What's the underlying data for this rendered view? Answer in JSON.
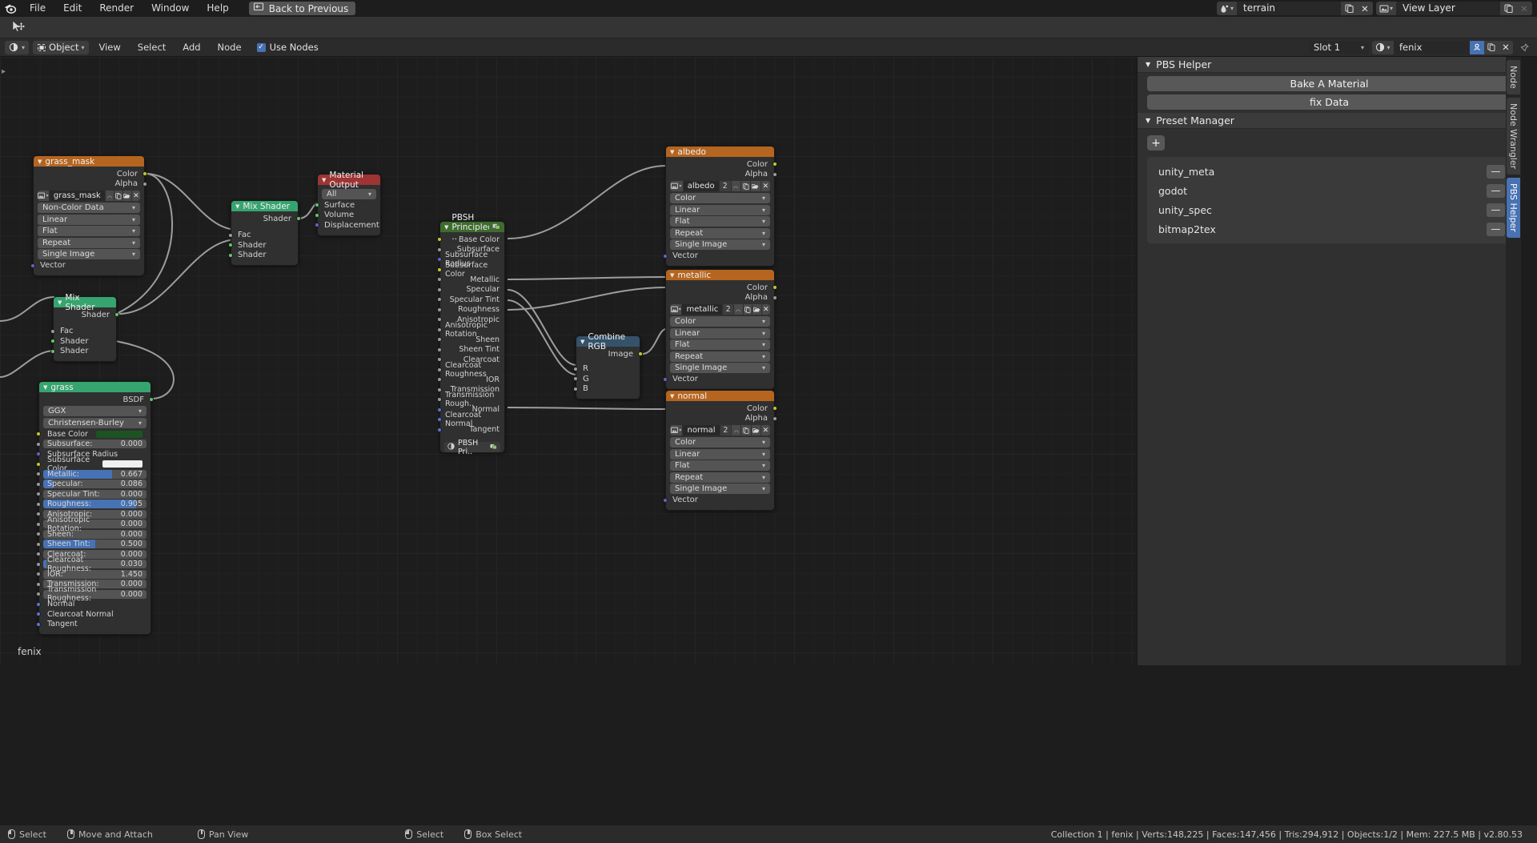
{
  "topbar": {
    "menus": [
      "File",
      "Edit",
      "Render",
      "Window",
      "Help"
    ],
    "back_button": "Back to Previous",
    "scene_name": "terrain",
    "view_layer_name": "View Layer"
  },
  "editor_header": {
    "mode": "Object",
    "menus": [
      "View",
      "Select",
      "Add",
      "Node"
    ],
    "use_nodes_label": "Use Nodes",
    "slot": "Slot 1",
    "material": "fenix"
  },
  "canvas": {
    "footer_label": "fenix"
  },
  "nodes": {
    "grass_mask": {
      "title": "grass_mask",
      "outputs": [
        "Color",
        "Alpha"
      ],
      "image_name": "grass_mask",
      "dropdowns": [
        "Non-Color Data",
        "Linear",
        "Flat",
        "Repeat",
        "Single Image"
      ],
      "inputs": [
        "Vector"
      ]
    },
    "mix_shader_top": {
      "title": "Mix Shader",
      "outputs": [
        "Shader"
      ],
      "inputs": [
        "Fac",
        "Shader",
        "Shader"
      ]
    },
    "mix_shader_bottom": {
      "title": "Mix Shader",
      "outputs": [
        "Shader"
      ],
      "inputs": [
        "Fac",
        "Shader",
        "Shader"
      ]
    },
    "material_output": {
      "title": "Material Output",
      "target": "All",
      "inputs": [
        "Surface",
        "Volume",
        "Displacement"
      ]
    },
    "grass": {
      "title": "grass",
      "outputs": [
        "BSDF"
      ],
      "distribution": "GGX",
      "subsurface_method": "Christensen-Burley",
      "params": [
        {
          "label": "Base Color",
          "type": "color",
          "color": "#1d5223"
        },
        {
          "label": "Subsurface:",
          "type": "slider",
          "value": "0.000",
          "fill": 0
        },
        {
          "label": "Subsurface Radius",
          "type": "plain",
          "value": ""
        },
        {
          "label": "Subsurface Color",
          "type": "color",
          "color": "#f0f0f0"
        },
        {
          "label": "Metallic:",
          "type": "slider",
          "value": "0.667",
          "fill": 67
        },
        {
          "label": "Specular:",
          "type": "slider",
          "value": "0.086",
          "fill": 9
        },
        {
          "label": "Specular Tint:",
          "type": "slider",
          "value": "0.000",
          "fill": 0
        },
        {
          "label": "Roughness:",
          "type": "slider",
          "value": "0.905",
          "fill": 90
        },
        {
          "label": "Anisotropic:",
          "type": "slider",
          "value": "0.000",
          "fill": 0
        },
        {
          "label": "Anisotropic Rotation:",
          "type": "slider",
          "value": "0.000",
          "fill": 0
        },
        {
          "label": "Sheen:",
          "type": "slider",
          "value": "0.000",
          "fill": 0
        },
        {
          "label": "Sheen Tint:",
          "type": "slider",
          "value": "0.500",
          "fill": 50
        },
        {
          "label": "Clearcoat:",
          "type": "slider",
          "value": "0.000",
          "fill": 0
        },
        {
          "label": "Clearcoat Roughness:",
          "type": "slider",
          "value": "0.030",
          "fill": 3
        },
        {
          "label": "IOR:",
          "type": "slider",
          "value": "1.450",
          "fill": 0
        },
        {
          "label": "Transmission:",
          "type": "slider",
          "value": "0.000",
          "fill": 0
        },
        {
          "label": "Transmission Roughness:",
          "type": "slider",
          "value": "0.000",
          "fill": 0
        },
        {
          "label": "Normal",
          "type": "plain",
          "value": ""
        },
        {
          "label": "Clearcoat Normal",
          "type": "plain",
          "value": ""
        },
        {
          "label": "Tangent",
          "type": "plain",
          "value": ""
        }
      ]
    },
    "pbsh_principled": {
      "title": "PBSH Principled ..",
      "inputs": [
        "Base Color",
        "Subsurface",
        "Subsurface Radius",
        "Subsurface Color",
        "Metallic",
        "Specular",
        "Specular Tint",
        "Roughness",
        "Anisotropic",
        "Anisotropic Rotation",
        "Sheen",
        "Sheen Tint",
        "Clearcoat",
        "Clearcoat Roughness",
        "IOR",
        "Transmission",
        "Transmission Rough..",
        "Normal",
        "Clearcoat Normal",
        "Tangent"
      ],
      "footer_label": "PBSH Pri.."
    },
    "combine_rgb": {
      "title": "Combine RGB",
      "outputs": [
        "Image"
      ],
      "inputs": [
        "R",
        "G",
        "B"
      ]
    },
    "albedo": {
      "title": "albedo",
      "outputs": [
        "Color",
        "Alpha"
      ],
      "image_name": "albedo",
      "users": "2",
      "dropdowns": [
        "Color",
        "Linear",
        "Flat",
        "Repeat",
        "Single Image"
      ],
      "inputs": [
        "Vector"
      ]
    },
    "metallic": {
      "title": "metallic",
      "outputs": [
        "Color",
        "Alpha"
      ],
      "image_name": "metallic",
      "users": "2",
      "dropdowns": [
        "Color",
        "Linear",
        "Flat",
        "Repeat",
        "Single Image"
      ],
      "inputs": [
        "Vector"
      ]
    },
    "normal": {
      "title": "normal",
      "outputs": [
        "Color",
        "Alpha"
      ],
      "image_name": "normal",
      "users": "2",
      "dropdowns": [
        "Color",
        "Linear",
        "Flat",
        "Repeat",
        "Single Image"
      ],
      "inputs": [
        "Vector"
      ]
    }
  },
  "sidebar": {
    "pbs_helper": {
      "title": "PBS Helper",
      "buttons": [
        "Bake A Material",
        "fix Data"
      ]
    },
    "preset_manager": {
      "title": "Preset Manager",
      "add_label": "+",
      "presets": [
        "unity_meta",
        "godot",
        "unity_spec",
        "bitmap2tex"
      ],
      "remove_label": "—"
    },
    "tabs": [
      {
        "label": "Node",
        "active": false
      },
      {
        "label": "Node Wrangler",
        "active": false
      },
      {
        "label": "PBS Helper",
        "active": true
      }
    ]
  },
  "statusbar": {
    "hints": [
      {
        "mouse": "left",
        "label": "Select"
      },
      {
        "mouse": "middle",
        "label": "Move and Attach"
      },
      {
        "mouse": "middle2",
        "label": "Pan View"
      },
      {
        "mouse": "left2",
        "label": "Select"
      },
      {
        "mouse": "middle3",
        "label": "Box Select"
      }
    ],
    "stats": "Collection 1 | fenix | Verts:148,225 | Faces:147,456 | Tris:294,912 | Objects:1/2 | Mem: 227.5 MB | v2.80.53"
  },
  "colors": {
    "accent": "#4772b3",
    "texture_node_header": "#b5651f",
    "shader_node_header": "#36a46e",
    "output_node_header": "#9e3434",
    "converter_node_header": "#36526b",
    "group_node_header": "#3e6b2e"
  }
}
